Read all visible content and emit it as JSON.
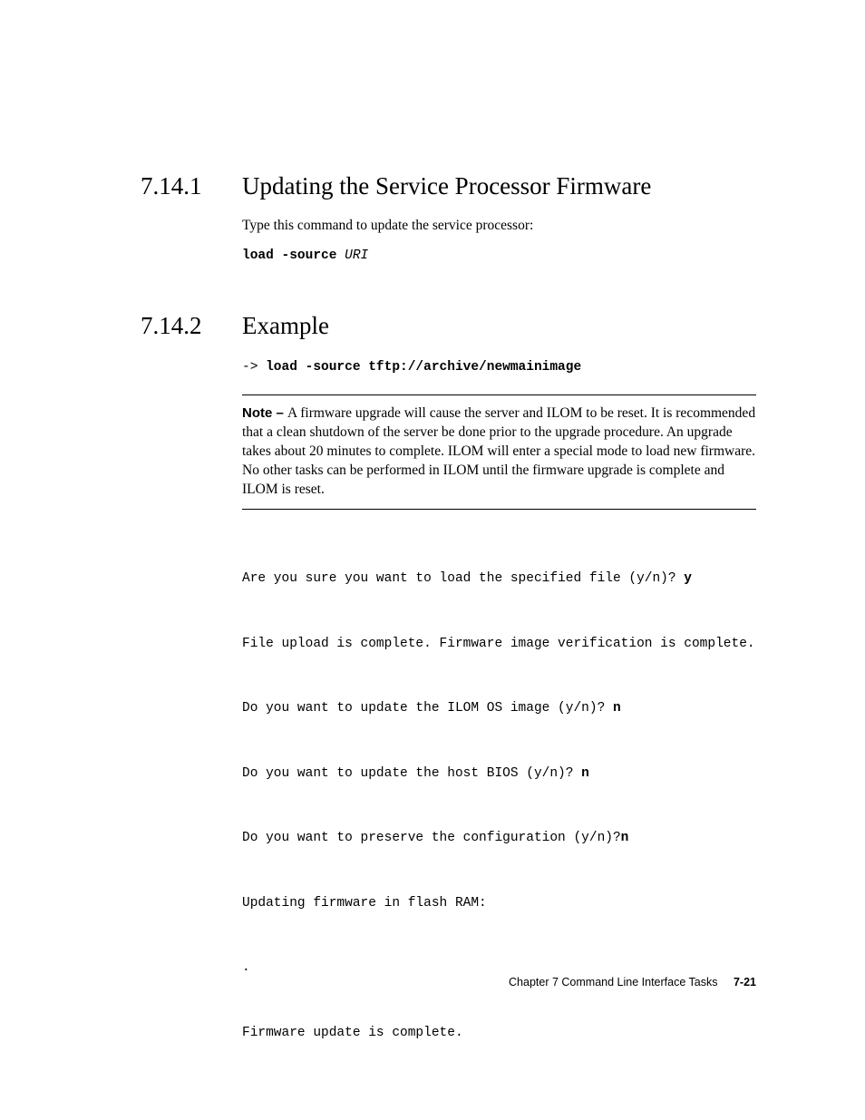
{
  "section1": {
    "number": "7.14.1",
    "title": "Updating the Service Processor Firmware",
    "intro": "Type this command to update the service processor:",
    "cmd_bold": "load -source",
    "cmd_arg": "URI"
  },
  "section2": {
    "number": "7.14.2",
    "title": "Example",
    "prompt": "-> ",
    "cmd": "load -source tftp://archive/newmainimage"
  },
  "note": {
    "label": "Note – ",
    "text": "A firmware upgrade will cause the server and ILOM to be reset. It is recommended that a clean shutdown of the server be done prior to the upgrade procedure. An upgrade takes about 20 minutes to complete. ILOM will enter a special mode to load new firmware. No other tasks can be performed in ILOM until the firmware upgrade is complete and ILOM is reset."
  },
  "terminal": {
    "l1_q": "Are you sure you want to load the specified file (y/n)? ",
    "l1_a": "y",
    "l2": "File upload is complete. Firmware image verification is complete.",
    "l3_q": "Do you want to update the ILOM OS image (y/n)? ",
    "l3_a": "n",
    "l4_q": "Do you want to update the host BIOS (y/n)? ",
    "l4_a": "n",
    "l5_q": "Do you want to preserve the configuration (y/n)?",
    "l5_a": "n",
    "l6": "Updating firmware in flash RAM:",
    "l7": ".",
    "l8": "Firmware update is complete."
  },
  "footer": {
    "chapter": "Chapter 7    Command Line Interface Tasks",
    "page": "7-21"
  }
}
